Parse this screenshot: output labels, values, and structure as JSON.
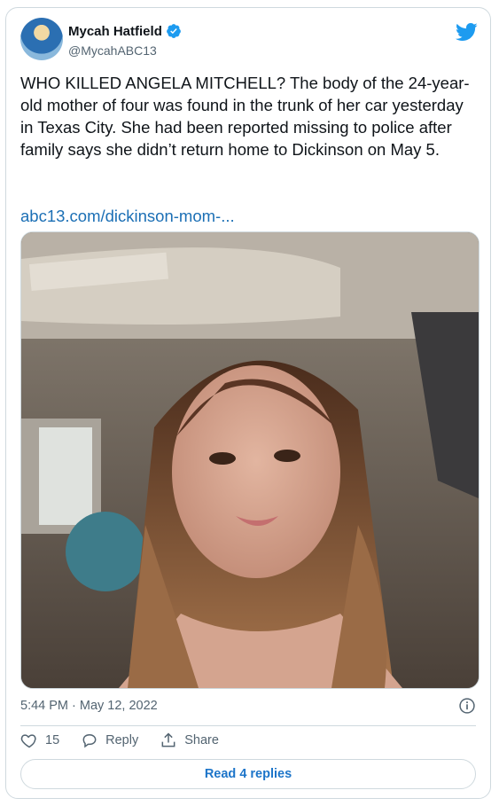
{
  "author": {
    "display_name": "Mycah Hatfield",
    "handle": "@MycahABC13",
    "verified": true
  },
  "tweet": {
    "text": "WHO KILLED ANGELA MITCHELL? The body of the 24-year-old mother of four was found in the trunk of her car yesterday in Texas City. She had been reported missing to police after family says she didn’t return home to Dickinson on May 5.",
    "link": "abc13.com/dickinson-mom-..."
  },
  "meta": {
    "timestamp": "5:44 PM · May 12, 2022"
  },
  "actions": {
    "like_count": "15",
    "reply_label": "Reply",
    "share_label": "Share"
  },
  "footer": {
    "read_replies_label": "Read 4 replies"
  },
  "icons": {
    "twitter_brand_color": "#1d9bf0",
    "verified_color": "#1d9bf0",
    "link_color": "#1b6fb5"
  }
}
